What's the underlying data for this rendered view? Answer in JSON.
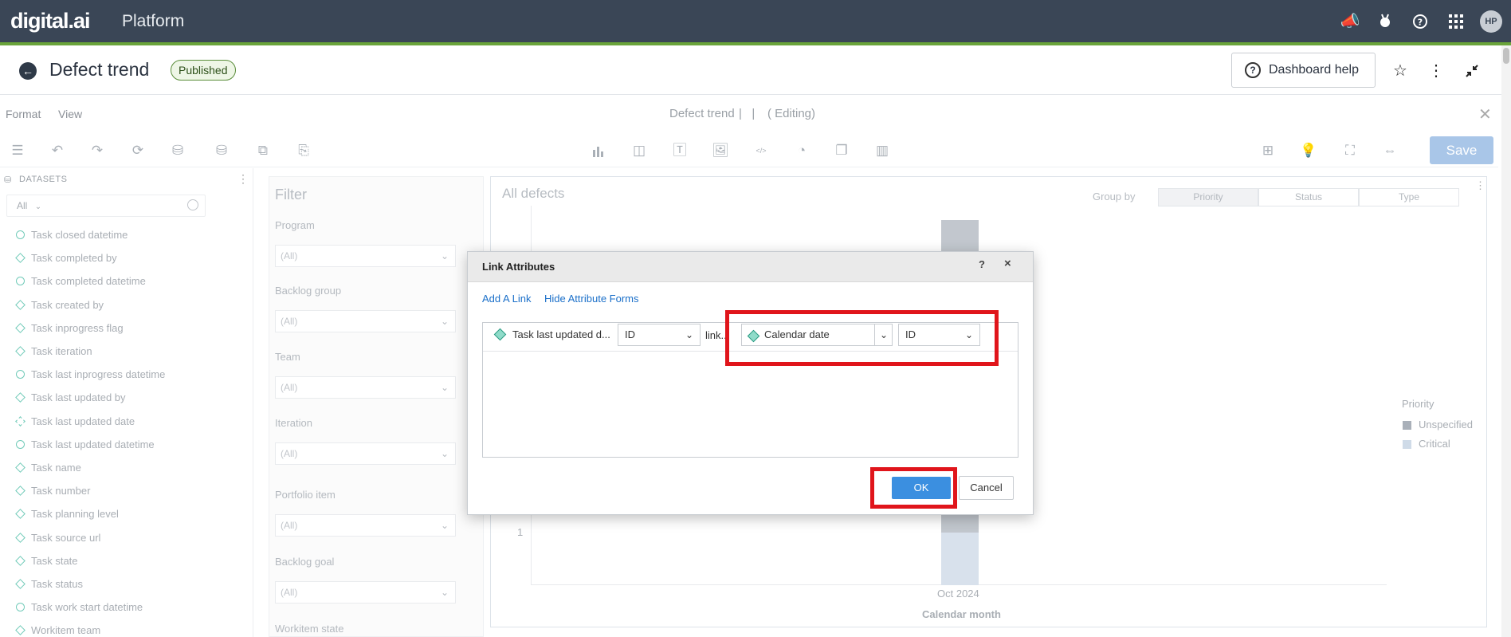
{
  "app": {
    "logo": "digital.ai",
    "product": "Platform",
    "avatar_initials": "HP"
  },
  "header": {
    "title": "Defect trend",
    "status_badge": "Published",
    "help_label": "Dashboard help"
  },
  "menu": {
    "format": "Format",
    "view": "View",
    "doc_title": "Defect trend",
    "editing": "( Editing)",
    "save_label": "Save"
  },
  "datasets": {
    "title": "DATASETS",
    "filter_value": "All",
    "items": [
      {
        "label": "Task closed datetime",
        "icon": "clock-icon"
      },
      {
        "label": "Task completed by",
        "icon": "attribute-icon"
      },
      {
        "label": "Task completed datetime",
        "icon": "clock-icon"
      },
      {
        "label": "Task created by",
        "icon": "attribute-icon"
      },
      {
        "label": "Task inprogress flag",
        "icon": "attribute-icon"
      },
      {
        "label": "Task iteration",
        "icon": "attribute-icon"
      },
      {
        "label": "Task last inprogress datetime",
        "icon": "clock-icon"
      },
      {
        "label": "Task last updated by",
        "icon": "attribute-icon"
      },
      {
        "label": "Task last updated date",
        "icon": "linked-attribute-icon"
      },
      {
        "label": "Task last updated datetime",
        "icon": "clock-icon"
      },
      {
        "label": "Task name",
        "icon": "attribute-icon"
      },
      {
        "label": "Task number",
        "icon": "attribute-icon"
      },
      {
        "label": "Task planning level",
        "icon": "attribute-icon"
      },
      {
        "label": "Task source url",
        "icon": "attribute-icon"
      },
      {
        "label": "Task state",
        "icon": "attribute-icon"
      },
      {
        "label": "Task status",
        "icon": "attribute-icon"
      },
      {
        "label": "Task work start datetime",
        "icon": "clock-icon"
      },
      {
        "label": "Workitem team",
        "icon": "attribute-icon"
      }
    ]
  },
  "filter": {
    "title": "Filter",
    "fields": [
      {
        "label": "Program",
        "value": "(All)"
      },
      {
        "label": "Backlog group",
        "value": "(All)"
      },
      {
        "label": "Team",
        "value": "(All)"
      },
      {
        "label": "Iteration",
        "value": "(All)"
      },
      {
        "label": "Portfolio item",
        "value": "(All)"
      },
      {
        "label": "Backlog goal",
        "value": "(All)"
      },
      {
        "label": "Workitem state",
        "value": ""
      }
    ]
  },
  "chart": {
    "title": "All defects",
    "group_by_label": "Group by",
    "group_by_options": [
      "Priority",
      "Status",
      "Type"
    ],
    "legend_title": "Priority",
    "legend": [
      {
        "name": "Unspecified",
        "color": "#a9b0b9"
      },
      {
        "name": "Critical",
        "color": "#cfdbe8"
      }
    ],
    "y_tick": "1",
    "x_tick": "Oct 2024",
    "x_label": "Calendar month"
  },
  "chart_data": {
    "type": "bar",
    "categories": [
      "Oct 2024"
    ],
    "xlabel": "Calendar month",
    "legend_title": "Priority",
    "series": [
      {
        "name": "Unspecified"
      },
      {
        "name": "Critical"
      }
    ]
  },
  "dialog": {
    "title": "Link Attributes",
    "help": "?",
    "close": "×",
    "add_link": "Add A Link",
    "hide_forms": "Hide Attribute Forms",
    "source_attribute": "Task last updated d...",
    "source_form": "ID",
    "link_text": "link...",
    "target_attribute": "Calendar date",
    "target_form": "ID",
    "ok_label": "OK",
    "cancel_label": "Cancel"
  }
}
